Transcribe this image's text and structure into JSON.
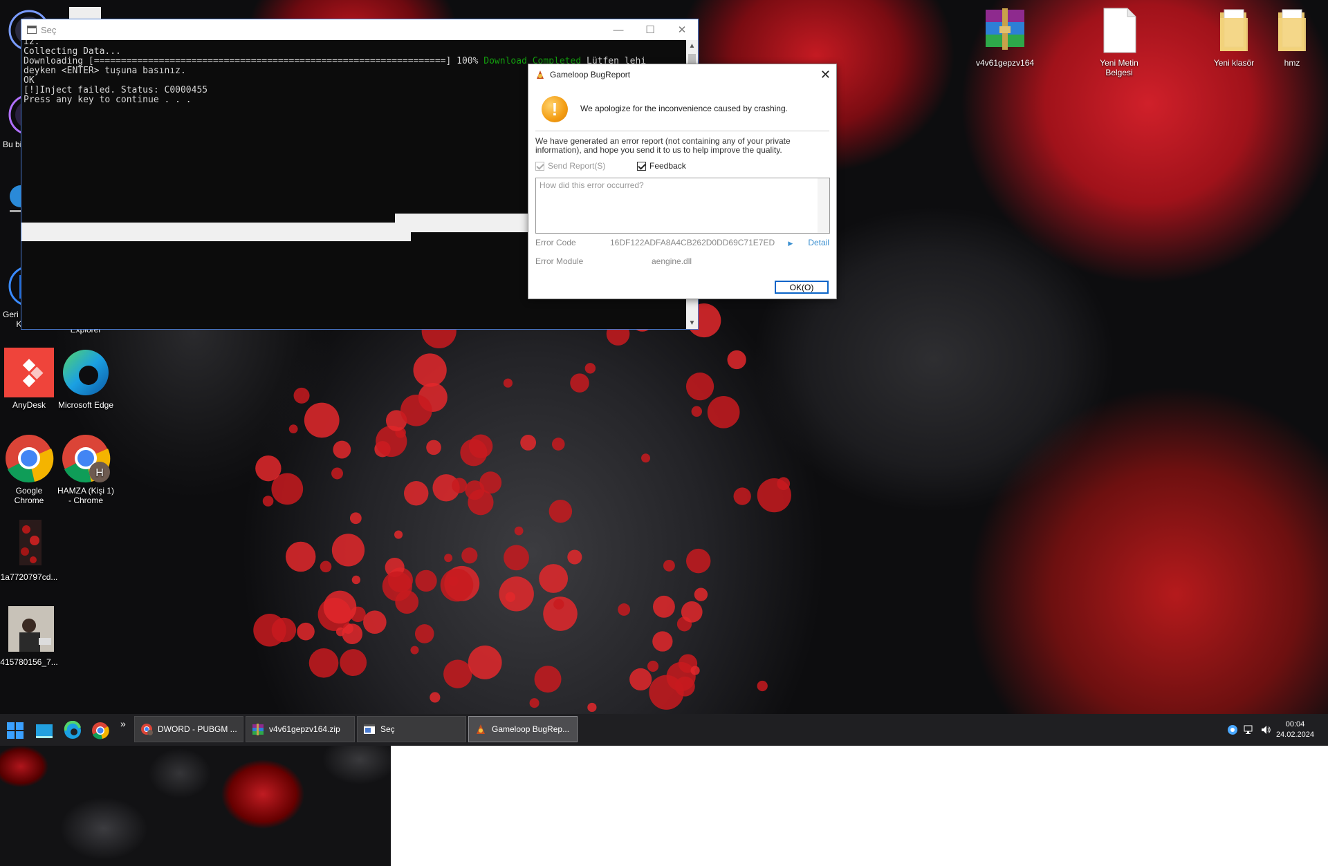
{
  "desktop": {
    "left_icons": [
      {
        "label": "Bu bi",
        "icon": "this-pc-icon"
      },
      {
        "label": "Geri D... Kutusu",
        "icon": "recycle-bin-icon"
      },
      {
        "label": "Explorer",
        "icon": "explorer-icon"
      },
      {
        "label": "AnyDesk",
        "icon": "anydesk-icon"
      },
      {
        "label": "Microsoft Edge",
        "icon": "edge-icon"
      },
      {
        "label": "Google Chrome",
        "icon": "chrome-icon"
      },
      {
        "label": "HAMZA (Kişi 1) - Chrome",
        "icon": "chrome-profile-icon"
      },
      {
        "label": "1a7720797cd...",
        "icon": "image-file-icon"
      },
      {
        "label": "415780156_7...",
        "icon": "photo-file-icon"
      }
    ],
    "right_icons": [
      {
        "label": "v4v61gepzv164",
        "icon": "winrar-archive-icon"
      },
      {
        "label": "Yeni Metin Belgesi",
        "icon": "text-document-icon"
      },
      {
        "label": "Yeni klasör",
        "icon": "folder-icon"
      },
      {
        "label": "hmz",
        "icon": "folder-icon"
      }
    ],
    "labels": {
      "bubi": "Bu bi",
      "geri": "Geri D",
      "kutusu": "Kutusu",
      "explorer": "Explorer",
      "anydesk": "AnyDesk",
      "edge": "Microsoft Edge",
      "chrome": "Google Chrome",
      "hamza": "HAMZA (Kişi 1) - Chrome",
      "img1": "1a7720797cd...",
      "img2": "415780156_7...",
      "winrar": "v4v61gepzv164",
      "txt": "Yeni Metin Belgesi",
      "folder1": "Yeni klasör",
      "folder2": "hmz"
    }
  },
  "console": {
    "title": "Seç",
    "lines": [
      "ız.",
      "Collecting Data...",
      "Downloading [=================================================================] 100%",
      "deyken <ENTER> tuşuna basınız.",
      "OK",
      "[!]Inject failed. Status: C0000455",
      "Press any key to continue . . ."
    ],
    "download_status": "Download Completed",
    "line3_tail": "Lütfen lehi"
  },
  "dialog": {
    "title": "Gameloop BugReport",
    "apology": "We apologize for the inconvenience caused by crashing.",
    "description": "We have generated an error report (not containing any of your private information), and hope you send it to us to help improve the quality.",
    "send_report_label": "Send Report(S)",
    "feedback_label": "Feedback",
    "feedback_placeholder": "How did this error occurred?",
    "error_code_label": "Error Code",
    "error_code_value": "16DF122ADFA8A4CB262D0DD69C71E7ED",
    "detail_label": "Detail",
    "error_module_label": "Error Module",
    "error_module_value": "aengine.dll",
    "ok_label": "OK(O)"
  },
  "taskbar": {
    "pinned": [
      "start-icon",
      "explorer-icon",
      "edge-icon",
      "chrome-icon"
    ],
    "overflow": "»",
    "items": [
      {
        "label": "DWORD - PUBGM ...",
        "icon": "chrome-profile-icon",
        "active": false
      },
      {
        "label": "v4v61gepzv164.zip",
        "icon": "winrar-archive-icon",
        "active": false
      },
      {
        "label": "Seç",
        "icon": "console-icon",
        "active": false
      },
      {
        "label": "Gameloop BugRep...",
        "icon": "gameloop-icon",
        "active": true
      }
    ],
    "clock_time": "00:04",
    "clock_date": "24.02.2024"
  },
  "colors": {
    "console_bg": "#0c0c0c",
    "console_text": "#d8d8d8",
    "download_green": "#13a10e",
    "accent_blue": "#0a64c8",
    "warning_orange": "#f39c12",
    "taskbar_bg": "#1f1f22"
  }
}
